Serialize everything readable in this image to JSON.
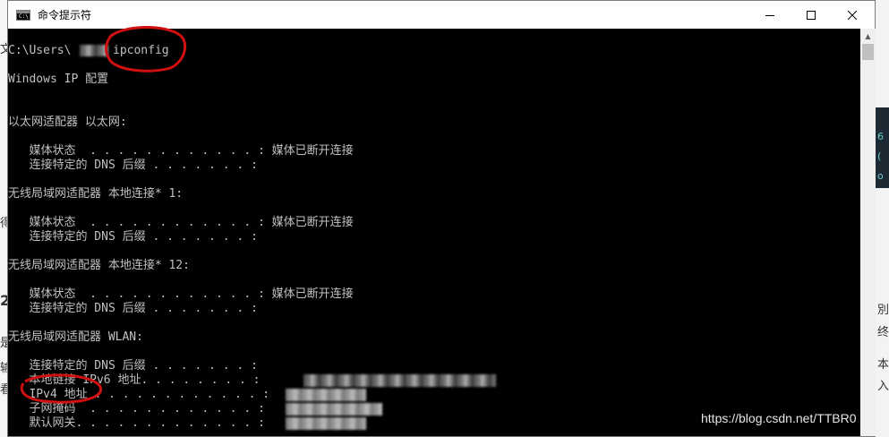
{
  "window": {
    "title": "命令提示符",
    "icon": "console-icon",
    "icon_text": "C:\\"
  },
  "controls": {
    "minimize_glyph": "—",
    "maximize_glyph": "☐",
    "close_glyph": "✕"
  },
  "console": {
    "lines": [
      "C:\\Users\\",
      "ipconfig",
      "Windows IP 配置",
      "以太网适配器 以太网:",
      "   媒体状态  . . . . . . . . . . . . : 媒体已断开连接",
      "   连接特定的 DNS 后缀 . . . . . . . :",
      "无线局域网适配器 本地连接* 1:",
      "   媒体状态  . . . . . . . . . . . . : 媒体已断开连接",
      "   连接特定的 DNS 后缀 . . . . . . . :",
      "无线局域网适配器 本地连接* 12:",
      "   媒体状态  . . . . . . . . . . . . : 媒体已断开连接",
      "   连接特定的 DNS 后缀 . . . . . . . :",
      "无线局域网适配器 WLAN:",
      "   连接特定的 DNS 后缀 . . . . . . . :",
      "   本地链接 IPv6 地址. . . . . . . . :",
      "   IPv4 地址 . . . . . . . . . . . . :",
      "   子网掩码  . . . . . . . . . . . . :",
      "   默认网关. . . . . . . . . . . . . :"
    ]
  },
  "watermark": "https://blog.csdn.net/TTBR0",
  "colors": {
    "console_bg": "#000000",
    "console_text": "#c0c0c0",
    "annotation": "#d01010"
  }
}
